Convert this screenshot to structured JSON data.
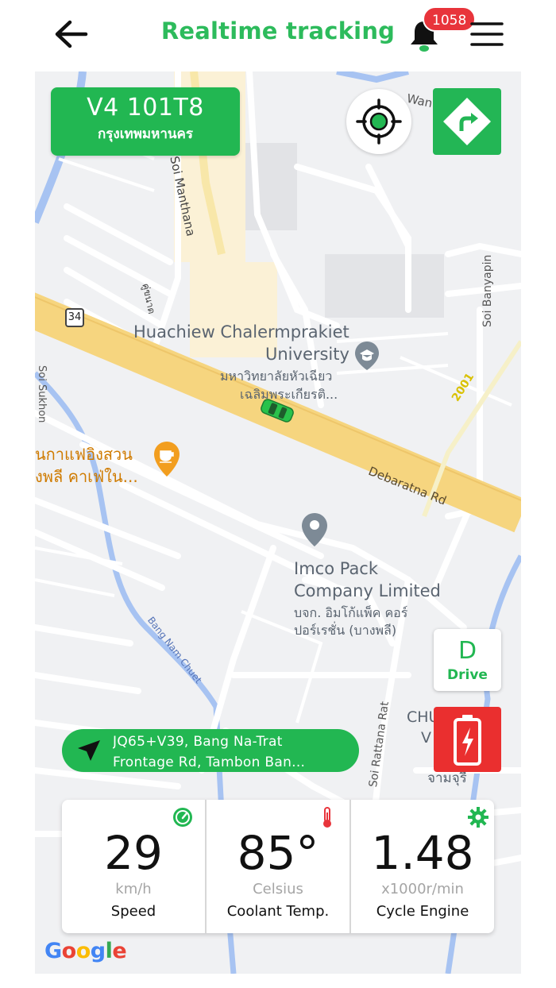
{
  "header": {
    "title": "Realtime tracking",
    "notification_count": "1058",
    "back_icon": "arrow-left-icon",
    "bell_icon": "bell-icon",
    "menu_icon": "hamburger-menu-icon"
  },
  "vehicle": {
    "plate_number": "V4 101T8",
    "province": "กรุงเทพมหานคร"
  },
  "map": {
    "labels": {
      "soi_manthana": "Soi Manthana",
      "soi_thai_1": "คู่ขนาด",
      "route_34": "34",
      "huachiew_en_1": "Huachiew Chalermprakiet",
      "huachiew_en_2": "University",
      "huachiew_th_1": "มหาวิทยาลัยหัวเฉียว",
      "huachiew_th_2": "เฉลิมพระเกียรติ...",
      "soi_banyapin": "Soi Banyapin",
      "road_2001": "2001",
      "wan": "Wan",
      "cafe_th_1": "นกาแฟอิงสวน",
      "cafe_th_2": "งพลี คาเฟ่ใน...",
      "debaratna": "Debaratna Rd",
      "imco_en_1": "Imco Pack",
      "imco_en_2": "Company Limited",
      "imco_th_1": "บจก. อิมโก้แพ็ค คอร์",
      "imco_th_2": "ปอร์เรชั่น (บางพลี)",
      "bang_nam_chuet": "Bang Nam Chuet",
      "soi_rattana": "Soi Rattana Rat",
      "chu": "CHU",
      "v": "V",
      "jamjura": "จามจุรี",
      "left_soi": "Soi Sukhon"
    },
    "google_logo": "Google"
  },
  "gear": {
    "value": "D",
    "label": "Drive"
  },
  "address": {
    "line1": "JQ65+V39, Bang Na-Trat",
    "line2": "Frontage Rd, Tambon Ban..."
  },
  "gauges": [
    {
      "value": "29",
      "unit": "km/h",
      "label": "Speed",
      "icon": "speedometer-icon"
    },
    {
      "value": "85°",
      "unit": "Celsius",
      "label": "Coolant Temp.",
      "icon": "thermometer-icon"
    },
    {
      "value": "1.48",
      "unit": "x1000r/min",
      "label": "Cycle Engine",
      "icon": "gear-icon"
    }
  ],
  "colors": {
    "accent_green": "#22b752",
    "badge_red": "#e8343b",
    "battery_red": "#ea2f2f",
    "road_yellow": "#f6d57f",
    "water_blue": "#a7c3f2"
  }
}
